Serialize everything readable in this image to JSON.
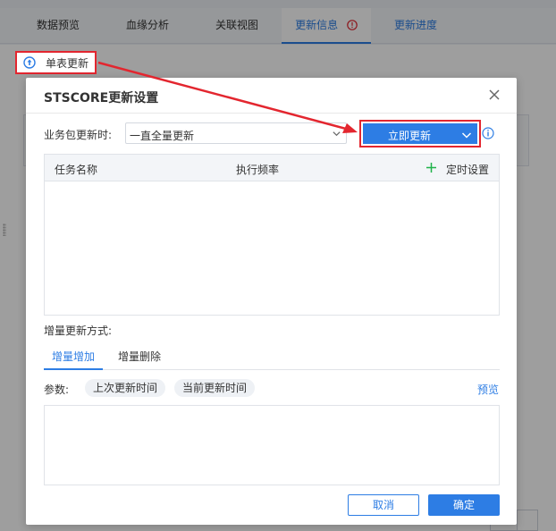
{
  "background": {
    "tabs": [
      {
        "label": "数据预览"
      },
      {
        "label": "血缘分析"
      },
      {
        "label": "关联视图"
      },
      {
        "label": "更新信息"
      },
      {
        "label": "更新进度"
      }
    ],
    "single_update_label": "单表更新"
  },
  "dialog": {
    "title": "STSCORE更新设置",
    "package_update_label": "业务包更新时:",
    "package_update_value": "一直全量更新",
    "update_now_label": "立即更新",
    "grid": {
      "col_task_name": "任务名称",
      "col_frequency": "执行频率",
      "schedule_label": "定时设置"
    },
    "incremental_label": "增量更新方式:",
    "inc_tabs": [
      {
        "label": "增量增加"
      },
      {
        "label": "增量删除"
      }
    ],
    "params_label": "参数:",
    "param_chips": [
      {
        "label": "上次更新时间"
      },
      {
        "label": "当前更新时间"
      }
    ],
    "preview_label": "预览",
    "cancel_label": "取消",
    "confirm_label": "确定"
  },
  "colors": {
    "accent": "#2d7de4",
    "highlight": "#e3262f",
    "plus_green": "#1fb34a"
  },
  "icons": [
    "refresh-icon",
    "alert-circle-icon",
    "close-icon",
    "chevron-down-icon",
    "info-icon",
    "plus-icon"
  ]
}
